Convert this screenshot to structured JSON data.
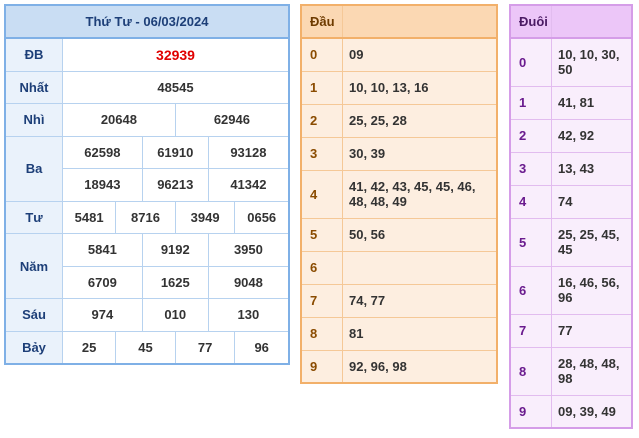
{
  "results": {
    "title": "Thứ Tư - 06/03/2024",
    "rows": [
      {
        "label": "ĐB",
        "values": [
          "32939"
        ]
      },
      {
        "label": "Nhất",
        "values": [
          "48545"
        ]
      },
      {
        "label": "Nhì",
        "values": [
          "20648",
          "62946"
        ]
      },
      {
        "label": "Ba",
        "values": [
          "62598",
          "61910",
          "93128",
          "18943",
          "96213",
          "41342"
        ]
      },
      {
        "label": "Tư",
        "values": [
          "5481",
          "8716",
          "3949",
          "0656"
        ]
      },
      {
        "label": "Năm",
        "values": [
          "5841",
          "9192",
          "3950",
          "6709",
          "1625",
          "9048"
        ]
      },
      {
        "label": "Sáu",
        "values": [
          "974",
          "010",
          "130"
        ]
      },
      {
        "label": "Bảy",
        "values": [
          "25",
          "45",
          "77",
          "96"
        ]
      }
    ]
  },
  "dau": {
    "header": "Đầu",
    "rows": [
      {
        "key": "0",
        "value": "09"
      },
      {
        "key": "1",
        "value": "10, 10, 13, 16"
      },
      {
        "key": "2",
        "value": "25, 25, 28"
      },
      {
        "key": "3",
        "value": "30, 39"
      },
      {
        "key": "4",
        "value": "41, 42, 43, 45, 45, 46, 48, 48, 49"
      },
      {
        "key": "5",
        "value": "50, 56"
      },
      {
        "key": "6",
        "value": ""
      },
      {
        "key": "7",
        "value": "74, 77"
      },
      {
        "key": "8",
        "value": "81"
      },
      {
        "key": "9",
        "value": "92, 96, 98"
      }
    ]
  },
  "duoi": {
    "header": "Đuôi",
    "rows": [
      {
        "key": "0",
        "value": "10, 10, 30, 50"
      },
      {
        "key": "1",
        "value": "41, 81"
      },
      {
        "key": "2",
        "value": "42, 92"
      },
      {
        "key": "3",
        "value": "13, 43"
      },
      {
        "key": "4",
        "value": "74"
      },
      {
        "key": "5",
        "value": "25, 25, 45, 45"
      },
      {
        "key": "6",
        "value": "16, 46, 56, 96"
      },
      {
        "key": "7",
        "value": "77"
      },
      {
        "key": "8",
        "value": "28, 48, 48, 98"
      },
      {
        "key": "9",
        "value": "09, 39, 49"
      }
    ]
  },
  "colors": {
    "special_prize": "#e00000",
    "results_accent": "#7fb0e6",
    "dau_accent": "#f2b06a",
    "duoi_accent": "#d59de8"
  }
}
